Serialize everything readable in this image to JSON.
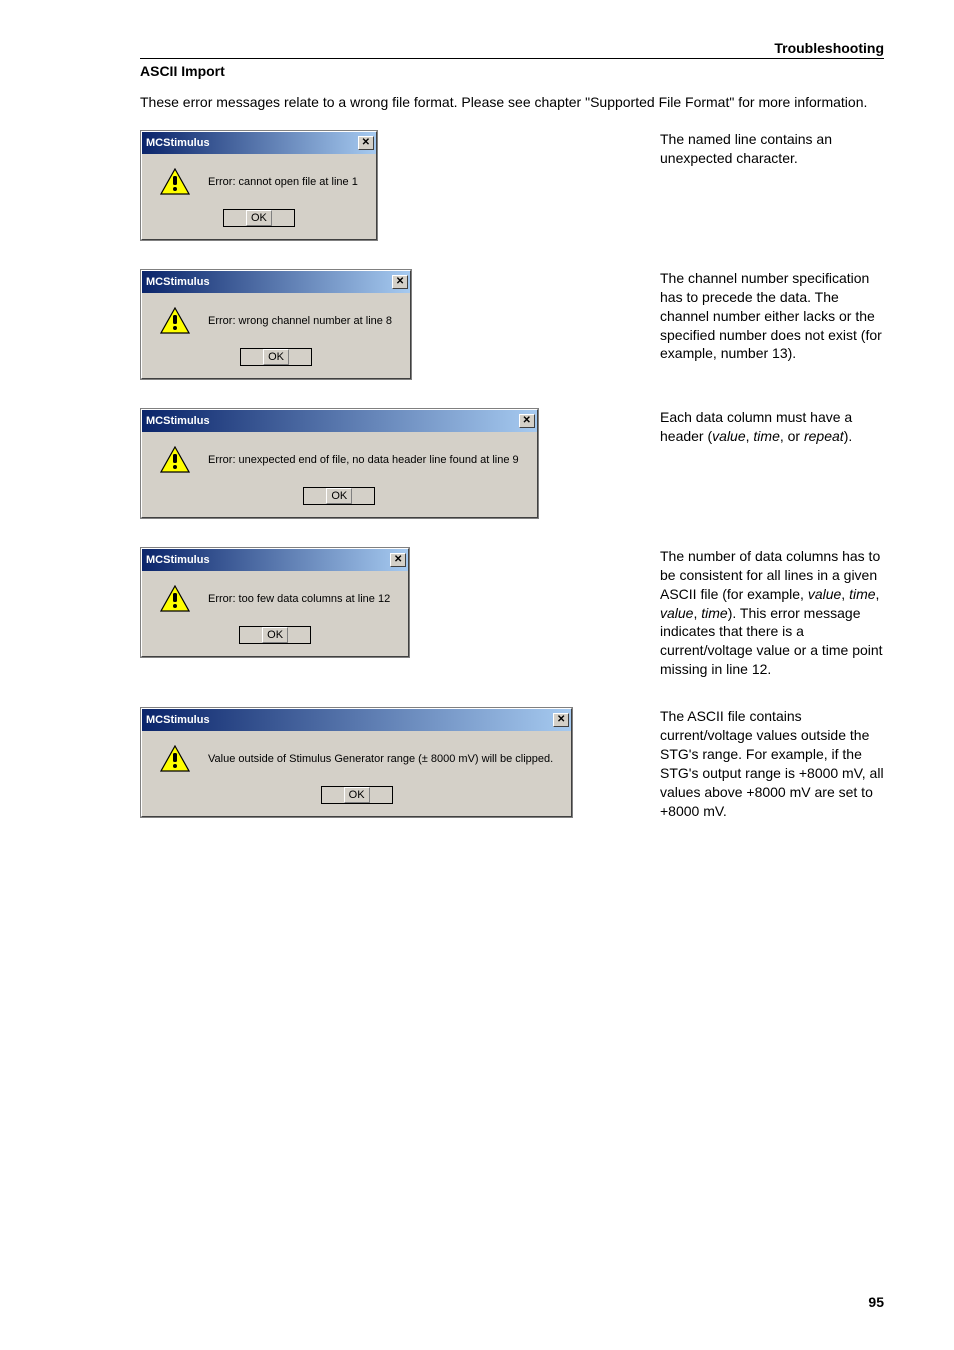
{
  "header": {
    "right": "Troubleshooting"
  },
  "section_title": "ASCII Import",
  "intro": "These error messages relate to a wrong file format. Please see chapter \"Supported File Format\" for more information.",
  "dialog_app_title": "MCStimulus",
  "close_glyph": "✕",
  "ok_label": "OK",
  "rows": [
    {
      "msg": "Error: cannot open file at line 1",
      "desc_html": "The named line contains an unexpected character."
    },
    {
      "msg": "Error: wrong channel number at line 8",
      "desc_html": "The channel number specification has to precede the data. The channel number either lacks or the specified number does not exist (for example, number 13)."
    },
    {
      "msg": "Error: unexpected end of file, no data header line found at line 9",
      "desc_html": "Each data column must have a header (<span class=\"italic\">value</span>, <span class=\"italic\">time</span>, or <span class=\"italic\">repeat</span>)."
    },
    {
      "msg": "Error: too few data columns at line 12",
      "desc_html": "The number of data columns has to be consistent for all lines in a given ASCII file (for example, <span class=\"italic\">value</span>, <span class=\"italic\">time</span>, <span class=\"italic\">value</span>, <span class=\"italic\">time</span>). This error message indicates that there is a current/voltage value or a time point missing in line 12."
    },
    {
      "msg": "Value outside of Stimulus Generator range (± 8000 mV) will be clipped.",
      "desc_html": "The ASCII file contains current/voltage values outside the STG's range. For example, if the STG's output range is +8000 mV, all values above +8000 mV are set to +8000 mV."
    }
  ],
  "page_number": "95"
}
